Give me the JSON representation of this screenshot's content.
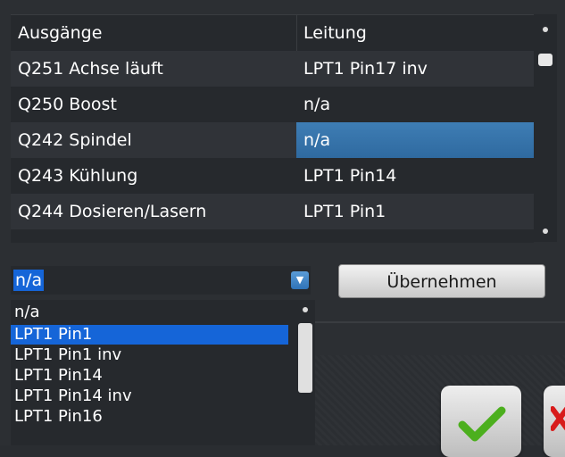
{
  "table": {
    "headers": [
      "Ausgänge",
      "Leitung"
    ],
    "rows": [
      {
        "output": "Q251 Achse läuft",
        "line": "LPT1 Pin17 inv"
      },
      {
        "output": "Q250 Boost",
        "line": "n/a"
      },
      {
        "output": "Q242 Spindel",
        "line": "n/a"
      },
      {
        "output": "Q243 Kühlung",
        "line": "LPT1 Pin14"
      },
      {
        "output": "Q244 Dosieren/Lasern",
        "line": "LPT1 Pin1"
      }
    ],
    "selected_row": 2
  },
  "combo": {
    "value": "n/a",
    "arrow_icon": "chevron-down-icon"
  },
  "apply_button": {
    "label": "Übernehmen"
  },
  "dropdown": {
    "options": [
      "n/a",
      "LPT1 Pin1",
      "LPT1 Pin1 inv",
      "LPT1 Pin14",
      "LPT1 Pin14 inv",
      "LPT1 Pin16"
    ],
    "highlighted": 1
  },
  "dialog_buttons": {
    "ok_icon": "checkmark-icon",
    "cancel_icon": "x-icon"
  },
  "colors": {
    "selection": "#1565d8",
    "selected_cell": "#3475ad",
    "ok_green": "#4caf1e",
    "cancel_red": "#d81b1b"
  }
}
